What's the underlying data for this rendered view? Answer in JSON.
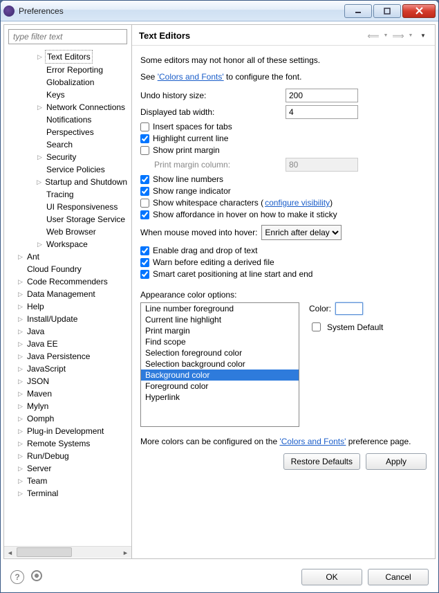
{
  "window": {
    "title": "Preferences"
  },
  "filter_placeholder": "type filter text",
  "tree": [
    {
      "depth": 3,
      "label": "Text Editors",
      "expandable": true,
      "selected": true
    },
    {
      "depth": 3,
      "label": "Error Reporting",
      "expandable": false
    },
    {
      "depth": 3,
      "label": "Globalization",
      "expandable": false
    },
    {
      "depth": 3,
      "label": "Keys",
      "expandable": false
    },
    {
      "depth": 3,
      "label": "Network Connections",
      "expandable": true
    },
    {
      "depth": 3,
      "label": "Notifications",
      "expandable": false
    },
    {
      "depth": 3,
      "label": "Perspectives",
      "expandable": false
    },
    {
      "depth": 3,
      "label": "Search",
      "expandable": false
    },
    {
      "depth": 3,
      "label": "Security",
      "expandable": true
    },
    {
      "depth": 3,
      "label": "Service Policies",
      "expandable": false
    },
    {
      "depth": 3,
      "label": "Startup and Shutdown",
      "expandable": true
    },
    {
      "depth": 3,
      "label": "Tracing",
      "expandable": false
    },
    {
      "depth": 3,
      "label": "UI Responsiveness",
      "expandable": false
    },
    {
      "depth": 3,
      "label": "User Storage Service",
      "expandable": false
    },
    {
      "depth": 3,
      "label": "Web Browser",
      "expandable": false
    },
    {
      "depth": 3,
      "label": "Workspace",
      "expandable": true
    },
    {
      "depth": 1,
      "label": "Ant",
      "expandable": true
    },
    {
      "depth": 1,
      "label": "Cloud Foundry",
      "expandable": false
    },
    {
      "depth": 1,
      "label": "Code Recommenders",
      "expandable": true
    },
    {
      "depth": 1,
      "label": "Data Management",
      "expandable": true
    },
    {
      "depth": 1,
      "label": "Help",
      "expandable": true
    },
    {
      "depth": 1,
      "label": "Install/Update",
      "expandable": true
    },
    {
      "depth": 1,
      "label": "Java",
      "expandable": true
    },
    {
      "depth": 1,
      "label": "Java EE",
      "expandable": true
    },
    {
      "depth": 1,
      "label": "Java Persistence",
      "expandable": true
    },
    {
      "depth": 1,
      "label": "JavaScript",
      "expandable": true
    },
    {
      "depth": 1,
      "label": "JSON",
      "expandable": true
    },
    {
      "depth": 1,
      "label": "Maven",
      "expandable": true
    },
    {
      "depth": 1,
      "label": "Mylyn",
      "expandable": true
    },
    {
      "depth": 1,
      "label": "Oomph",
      "expandable": true
    },
    {
      "depth": 1,
      "label": "Plug-in Development",
      "expandable": true
    },
    {
      "depth": 1,
      "label": "Remote Systems",
      "expandable": true
    },
    {
      "depth": 1,
      "label": "Run/Debug",
      "expandable": true
    },
    {
      "depth": 1,
      "label": "Server",
      "expandable": true
    },
    {
      "depth": 1,
      "label": "Team",
      "expandable": true
    },
    {
      "depth": 1,
      "label": "Terminal",
      "expandable": true
    }
  ],
  "page": {
    "heading": "Text Editors",
    "note": "Some editors may not honor all of these settings.",
    "see_pre": "See ",
    "see_link": "'Colors and Fonts'",
    "see_post": " to configure the font.",
    "undo_label": "Undo history size:",
    "undo_value": "200",
    "tab_label": "Displayed tab width:",
    "tab_value": "4",
    "chk_insert_spaces": "Insert spaces for tabs",
    "chk_highlight": "Highlight current line",
    "chk_show_margin": "Show print margin",
    "margin_label": "Print margin column:",
    "margin_value": "80",
    "chk_line_numbers": "Show line numbers",
    "chk_range": "Show range indicator",
    "chk_whitespace": "Show whitespace characters (",
    "whitespace_link": "configure visibility",
    "whitespace_close": ")",
    "chk_affordance": "Show affordance in hover on how to make it sticky",
    "hover_label": "When mouse moved into hover:",
    "hover_value": "Enrich after delay",
    "chk_drag": "Enable drag and drop of text",
    "chk_warn": "Warn before editing a derived file",
    "chk_smart": "Smart caret positioning at line start and end",
    "appearance_label": "Appearance color options:",
    "color_options": [
      "Line number foreground",
      "Current line highlight",
      "Print margin",
      "Find scope",
      "Selection foreground color",
      "Selection background color",
      "Background color",
      "Foreground color",
      "Hyperlink"
    ],
    "selected_color_index": 6,
    "color_label": "Color:",
    "system_default_label": "System Default",
    "more_pre": "More colors can be configured on the ",
    "more_link": "'Colors and Fonts'",
    "more_post": " preference page.",
    "restore_label": "Restore Defaults",
    "apply_label": "Apply"
  },
  "footer": {
    "ok": "OK",
    "cancel": "Cancel"
  }
}
